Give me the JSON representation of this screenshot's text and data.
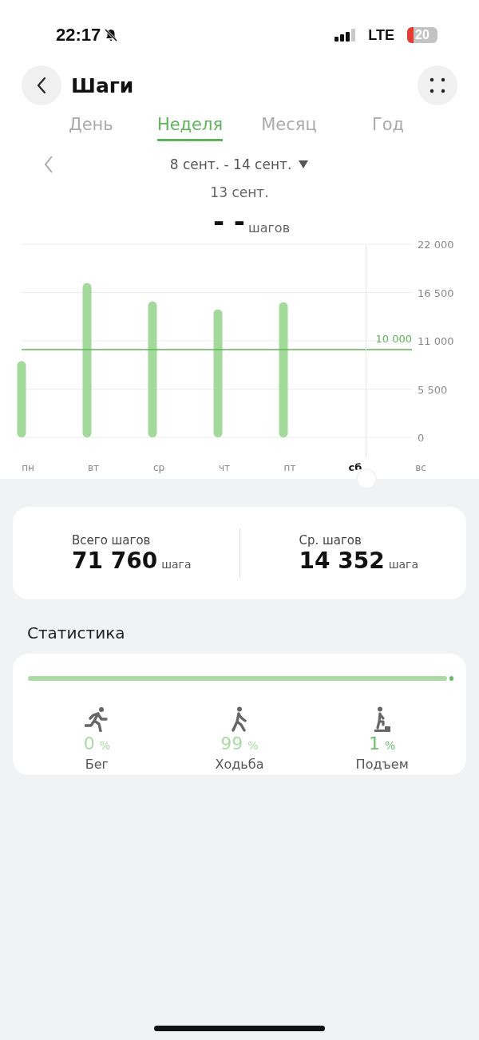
{
  "status_bar": {
    "time": "22:17",
    "network": "LTE",
    "battery": "20"
  },
  "header": {
    "title": "Шаги"
  },
  "tabs": [
    {
      "label": "День",
      "selected": false
    },
    {
      "label": "Неделя",
      "selected": true
    },
    {
      "label": "Месяц",
      "selected": false
    },
    {
      "label": "Год",
      "selected": false
    }
  ],
  "period": {
    "range": "8 сент. - 14 сент.",
    "date": "13 сент.",
    "value": "- -",
    "unit": "шагов"
  },
  "chart": {
    "chart_data": {
      "type": "bar",
      "categories": [
        "пн",
        "вт",
        "ср",
        "чт",
        "пт",
        "сб",
        "вс"
      ],
      "values": [
        8700,
        17600,
        15500,
        14600,
        15400,
        null,
        null
      ],
      "grid": true,
      "ylim": [
        0,
        22000
      ],
      "yticks": [
        0,
        {
          "value": 5500,
          "label": "5 500"
        },
        {
          "value": 11000,
          "label": "11 000"
        },
        {
          "value": 16500,
          "label": "16 500"
        },
        {
          "value": 22000,
          "label": "22 000"
        }
      ],
      "ref_lines": [
        {
          "axis": "y",
          "value": 10000,
          "label": "10 000",
          "color": "#5fb35a"
        }
      ]
    },
    "days": [
      {
        "selected": false
      },
      {
        "selected": false
      },
      {
        "selected": false
      },
      {
        "selected": false
      },
      {
        "selected": false
      },
      {
        "selected": true
      },
      {
        "selected": false
      }
    ]
  },
  "summary": [
    {
      "label": "Всего шагов",
      "value": "71 760",
      "unit": "шага"
    },
    {
      "label": "Ср. шагов",
      "value": "14 352",
      "unit": "шага"
    }
  ],
  "stats": {
    "title": "Статистика",
    "items": [
      {
        "kind": "run",
        "percent": "0",
        "unit": "%",
        "label": "Бег",
        "level": 0,
        "color": "#a9dba3"
      },
      {
        "kind": "walk",
        "percent": "99",
        "unit": "%",
        "label": "Ходьба",
        "level": 0.99,
        "color": "#a9dba3"
      },
      {
        "kind": "climb",
        "percent": "1",
        "unit": "%",
        "label": "Подъем",
        "level": 0.01,
        "color": "#6dbf6a"
      }
    ]
  }
}
